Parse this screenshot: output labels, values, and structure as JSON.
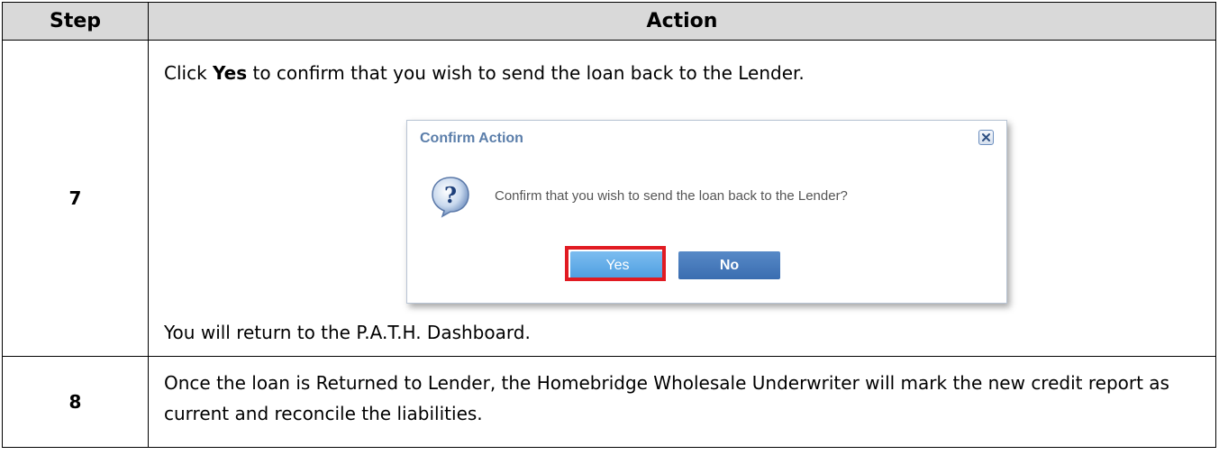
{
  "table": {
    "header": {
      "step": "Step",
      "action": "Action"
    },
    "rows": [
      {
        "step": "7",
        "instruction": {
          "prefix": "Click ",
          "bold": "Yes",
          "suffix": " to confirm that you wish to send the loan back to the Lender."
        },
        "dialog": {
          "title": "Confirm Action",
          "message": "Confirm that you wish to send the loan back to the Lender?",
          "yes_label": "Yes",
          "no_label": "No",
          "close_icon": "close-icon",
          "question_icon": "question-icon",
          "highlight_color": "#e11b22"
        },
        "note": "You will return to the P.A.T.H. Dashboard."
      },
      {
        "step": "8",
        "text": "Once the loan is Returned to Lender, the Homebridge Wholesale Underwriter will mark the new credit report as current and reconcile the liabilities."
      }
    ]
  }
}
